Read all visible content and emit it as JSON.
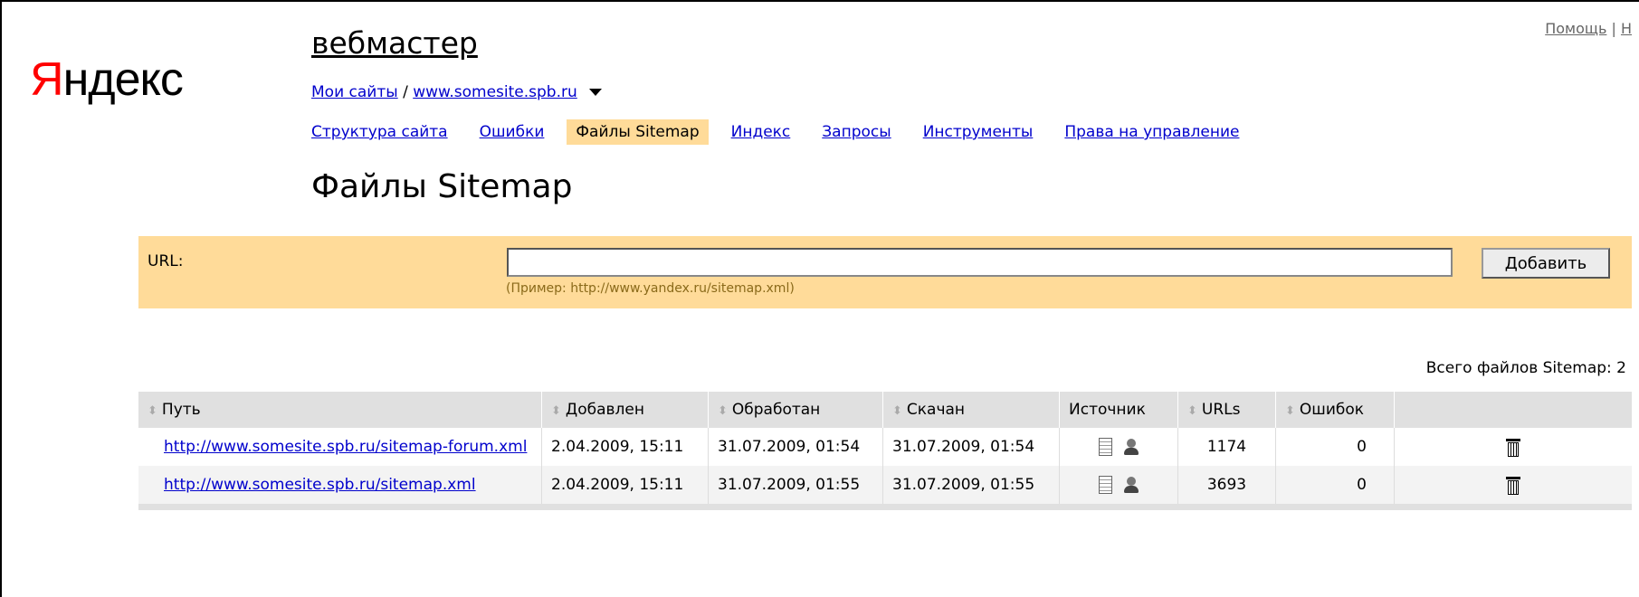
{
  "header": {
    "top_links": [
      {
        "label": "Помощь"
      },
      {
        "label": "Н"
      }
    ],
    "logo": {
      "first": "Я",
      "rest": "ндекс"
    },
    "service_title": "вебмастер"
  },
  "breadcrumb": {
    "my_sites": "Мои сайты",
    "separator": "/",
    "site": "www.somesite.spb.ru",
    "dropdown_icon": "triangle-down-icon"
  },
  "nav": {
    "tabs": [
      {
        "label": "Структура сайта",
        "active": false
      },
      {
        "label": "Ошибки",
        "active": false
      },
      {
        "label": "Файлы Sitemap",
        "active": true
      },
      {
        "label": "Индекс",
        "active": false
      },
      {
        "label": "Запросы",
        "active": false
      },
      {
        "label": "Инструменты",
        "active": false
      },
      {
        "label": "Права на управление",
        "active": false
      }
    ]
  },
  "page_title": "Файлы Sitemap",
  "form": {
    "url_label": "URL:",
    "url_value": "",
    "hint": "(Пример: http://www.yandex.ru/sitemap.xml)",
    "add_button": "Добавить"
  },
  "summary": "Всего файлов Sitemap: 2",
  "table": {
    "columns": [
      {
        "label": "Путь",
        "sortable": true
      },
      {
        "label": "Добавлен",
        "sortable": true
      },
      {
        "label": "Обработан",
        "sortable": true
      },
      {
        "label": "Скачан",
        "sortable": true
      },
      {
        "label": "Источник",
        "sortable": false
      },
      {
        "label": "URLs",
        "sortable": true
      },
      {
        "label": "Ошибок",
        "sortable": true
      },
      {
        "label": "",
        "sortable": false
      }
    ],
    "rows": [
      {
        "path": "http://www.somesite.spb.ru/sitemap-forum.xml",
        "added": "2.04.2009, 15:11",
        "processed": "31.07.2009, 01:54",
        "downloaded": "31.07.2009, 01:54",
        "source_icons": [
          "document-icon",
          "user-icon"
        ],
        "urls": "1174",
        "errors": "0"
      },
      {
        "path": "http://www.somesite.spb.ru/sitemap.xml",
        "added": "2.04.2009, 15:11",
        "processed": "31.07.2009, 01:55",
        "downloaded": "31.07.2009, 01:55",
        "source_icons": [
          "document-icon",
          "user-icon"
        ],
        "urls": "3693",
        "errors": "0"
      }
    ]
  },
  "colors": {
    "accent": "#ffdb99",
    "link": "#0000cc",
    "logo_red": "#ff0000",
    "table_header": "#e0e0e0"
  }
}
